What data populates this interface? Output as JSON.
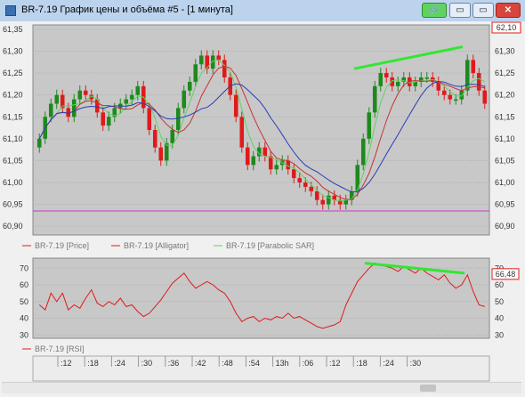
{
  "window": {
    "title": "BR-7.19 График цены и объёма #5 - [1 минута]",
    "buttons": {
      "link": "🔗",
      "minimize": "▭",
      "maximize": "▭",
      "close": "✕"
    }
  },
  "price_panel": {
    "y_ticks": [
      "61,35",
      "61,30",
      "61,25",
      "61,20",
      "61,15",
      "61,10",
      "61,05",
      "61,00",
      "60,95",
      "60,90"
    ],
    "last_price_badge": "62,10",
    "legend": [
      "BR-7.19 [Price]",
      "BR-7.19 [Alligator]",
      "BR-7.19 [Parabolic SAR]"
    ]
  },
  "rsi_panel": {
    "y_ticks": [
      "70",
      "60",
      "50",
      "40",
      "30"
    ],
    "last_value_badge": "66,48",
    "legend": [
      "BR-7.19 [RSI]"
    ]
  },
  "time_axis": {
    "labels": [
      ":12",
      ":18",
      ":24",
      ":30",
      ":36",
      ":42",
      ":48",
      ":54",
      "13h",
      ":06",
      ":12",
      ":18",
      ":24",
      ":30"
    ]
  },
  "colors": {
    "up": "#1d8a1d",
    "down": "#e01a1a",
    "alligator": "#c83232",
    "sar": "#5cd65c",
    "ma_blue": "#2b3bb5",
    "support": "#cc33cc",
    "trendline": "#33e633"
  },
  "chart_data": [
    {
      "type": "candlestick",
      "title": "",
      "ylim": [
        60.88,
        61.36
      ],
      "ylabel": "",
      "series": [
        {
          "name": "BR-7.19 [Price]",
          "values": [
            61.1,
            61.15,
            61.18,
            61.2,
            61.17,
            61.15,
            61.19,
            61.21,
            61.2,
            61.19,
            61.16,
            61.13,
            61.15,
            61.17,
            61.18,
            61.19,
            61.2,
            61.22,
            61.17,
            61.12,
            61.08,
            61.05,
            61.09,
            61.12,
            61.17,
            61.21,
            61.23,
            61.27,
            61.29,
            61.26,
            61.29,
            61.28,
            61.24,
            61.2,
            61.15,
            61.08,
            61.04,
            61.06,
            61.08,
            61.06,
            61.03,
            61.04,
            61.05,
            61.03,
            61.01,
            61.0,
            60.99,
            60.98,
            60.96,
            60.95,
            60.97,
            60.96,
            60.95,
            60.96,
            60.98,
            61.04,
            61.1,
            61.16,
            61.22,
            61.25,
            61.24,
            61.22,
            61.23,
            61.24,
            61.22,
            61.23,
            61.24,
            61.24,
            61.23,
            61.21,
            61.2,
            61.19,
            61.19,
            61.21,
            61.28,
            61.25,
            61.21,
            61.18
          ]
        },
        {
          "name": "BR-7.19 [Alligator]",
          "values": []
        },
        {
          "name": "BR-7.19 [Parabolic SAR]",
          "values": []
        }
      ],
      "support_level": 60.935,
      "trendline": {
        "from": 61.26,
        "to": 61.31
      }
    },
    {
      "type": "line",
      "title": "",
      "ylim": [
        28,
        76
      ],
      "series": [
        {
          "name": "BR-7.19 [RSI]",
          "values": [
            48,
            45,
            55,
            50,
            55,
            45,
            48,
            46,
            52,
            57,
            49,
            47,
            50,
            48,
            52,
            47,
            48,
            44,
            41,
            43,
            47,
            51,
            56,
            61,
            64,
            67,
            62,
            58,
            60,
            62,
            60,
            57,
            55,
            50,
            43,
            38,
            40,
            41,
            38,
            40,
            39,
            41,
            40,
            43,
            40,
            41,
            39,
            37,
            35,
            34,
            35,
            36,
            38,
            48,
            55,
            62,
            66,
            70,
            73,
            72,
            71,
            70,
            68,
            71,
            69,
            67,
            70,
            67,
            65,
            63,
            66,
            61,
            58,
            60,
            66,
            56,
            48,
            47
          ]
        }
      ],
      "trendline": {
        "from": 73,
        "to": 67
      }
    }
  ]
}
